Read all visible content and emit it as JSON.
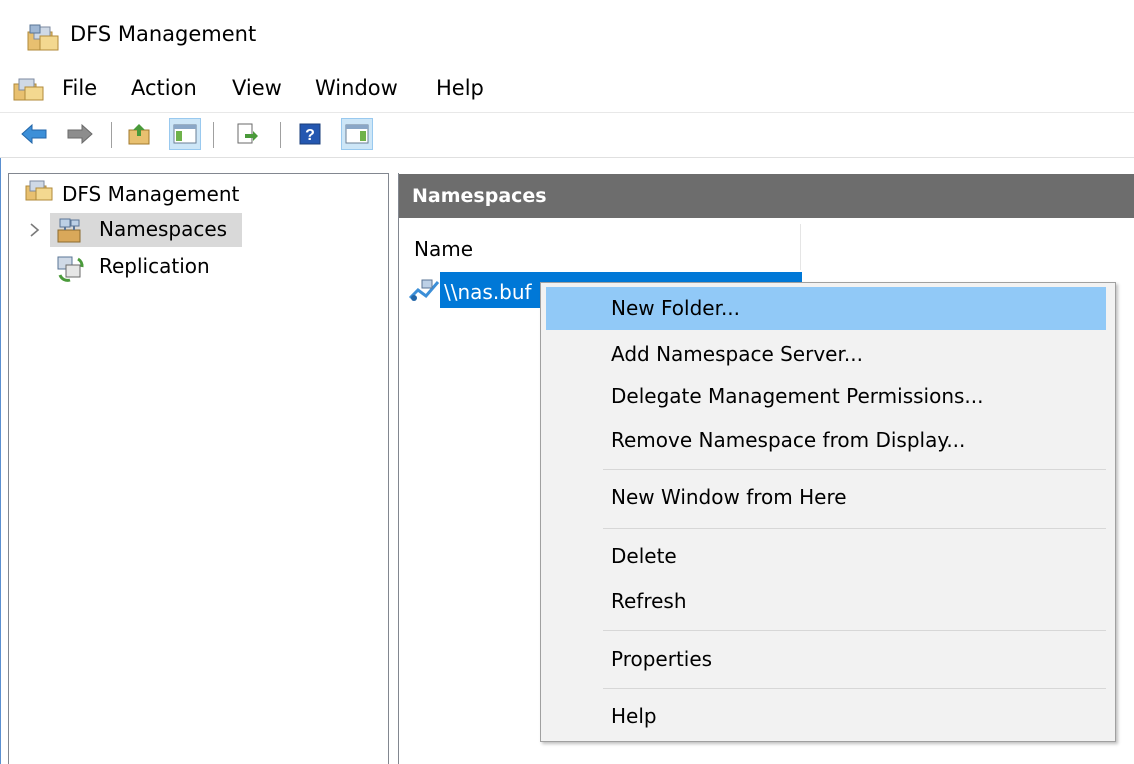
{
  "window": {
    "title": "DFS Management"
  },
  "menubar": {
    "items": [
      "File",
      "Action",
      "View",
      "Window",
      "Help"
    ]
  },
  "toolbar": {
    "buttons": [
      "back-icon",
      "forward-icon",
      "up-folder-icon",
      "show-hide-console-tree-icon",
      "export-list-icon",
      "help-icon",
      "show-hide-action-pane-icon"
    ]
  },
  "tree": {
    "root": "DFS Management",
    "namespaces": "Namespaces",
    "replication": "Replication"
  },
  "pane": {
    "title": "Namespaces",
    "column_name": "Name",
    "row_value": "\\\\nas.buf"
  },
  "context_menu": {
    "new_folder": "New Folder...",
    "add_server": "Add Namespace Server...",
    "delegate": "Delegate Management Permissions...",
    "remove": "Remove Namespace from Display...",
    "new_window": "New Window from Here",
    "delete": "Delete",
    "refresh": "Refresh",
    "properties": "Properties",
    "help": "Help"
  },
  "colors": {
    "selection": "#0078d7",
    "menu_highlight": "#91c9f7",
    "pane_header": "#6d6d6d"
  }
}
